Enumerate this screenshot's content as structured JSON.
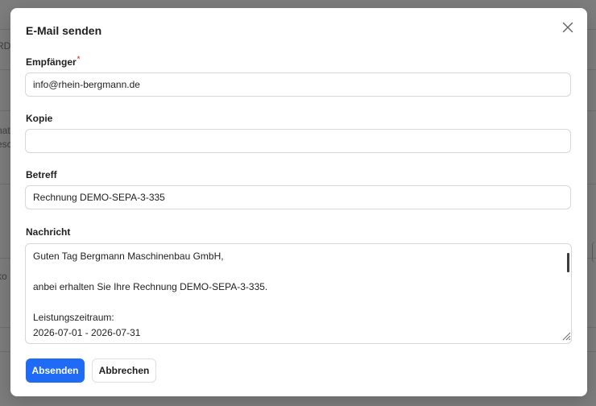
{
  "dialog": {
    "title": "E-Mail senden",
    "close_icon": "close-icon"
  },
  "fields": {
    "recipient": {
      "label": "Empfänger",
      "required_marker": "*",
      "value": "info@rhein-bergmann.de"
    },
    "cc": {
      "label": "Kopie",
      "value": ""
    },
    "subject": {
      "label": "Betreff",
      "value": "Rechnung DEMO-SEPA-3-335"
    },
    "message": {
      "label": "Nachricht",
      "value": "Guten Tag Bergmann Maschinenbau GmbH,\n\nanbei erhalten Sie Ihre Rechnung DEMO-SEPA-3-335.\n\nLeistungszeitraum:\n2026-07-01 - 2026-07-31"
    }
  },
  "buttons": {
    "send_label": "Absenden",
    "cancel_label": "Abbrechen"
  },
  "background": {
    "partial_texts": [
      "RD",
      "nat",
      "esc",
      "ko"
    ]
  },
  "colors": {
    "primary": "#1f6bf5",
    "required": "#e5484d",
    "overlay": "#7d7d7d"
  }
}
